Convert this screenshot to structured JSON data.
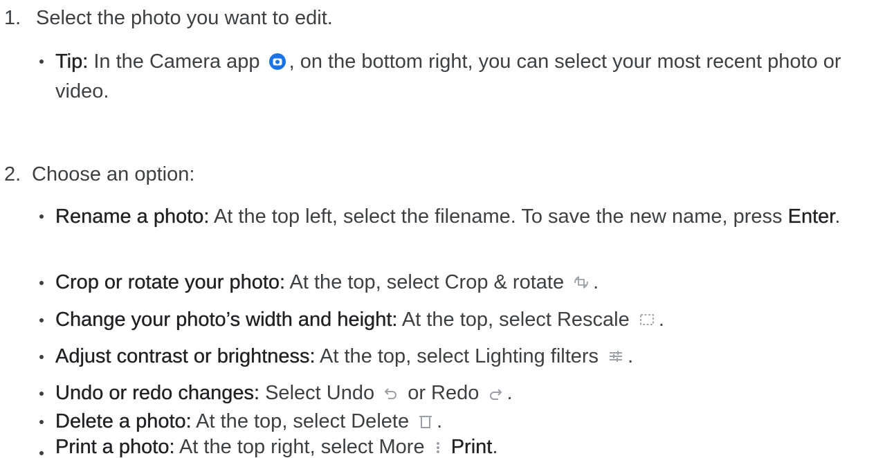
{
  "steps": [
    {
      "number": "1.",
      "text": "Select the photo you want to edit.",
      "bullets": [
        {
          "label": "Tip:",
          "before_icon": "In the Camera app",
          "icon": "camera-app-icon",
          "after_icon": ",  on the bottom right, you can select your most recent photo or video."
        }
      ]
    },
    {
      "number": "2.",
      "text": "Choose an option:",
      "bullets": [
        {
          "label": "Rename a photo:",
          "text": "At the top left, select the filename. To save the new name, press",
          "bold_end": "Enter",
          "end": "."
        },
        {
          "label": "Crop or rotate your photo:",
          "text": "At the top, select Crop & rotate",
          "icon": "crop-rotate-icon",
          "end": "."
        },
        {
          "label": "Change your photo’s width and height:",
          "text": "At the top, select Rescale",
          "icon": "rescale-icon",
          "end": "."
        },
        {
          "label": "Adjust contrast or brightness:",
          "text": "At the top, select Lighting filters",
          "icon": "lighting-filters-icon",
          "end": "."
        },
        {
          "label": "Undo or redo changes:",
          "text_a": "Select Undo",
          "icon_a": "undo-icon",
          "text_b": "or Redo",
          "icon_b": "redo-icon",
          "end": "."
        },
        {
          "label": "Delete a photo:",
          "text": "At the top, select Delete",
          "icon": "delete-icon",
          "end": "."
        },
        {
          "label": "Print a photo:",
          "text": "At the top right, select More",
          "icon": "more-vertical-icon",
          "bold_end": "Print",
          "end": "."
        }
      ]
    }
  ],
  "colors": {
    "text": "#3c4043",
    "strong": "#202124",
    "camera_icon": "#1a73e8",
    "toolbar_icon": "#9aa0a6"
  }
}
